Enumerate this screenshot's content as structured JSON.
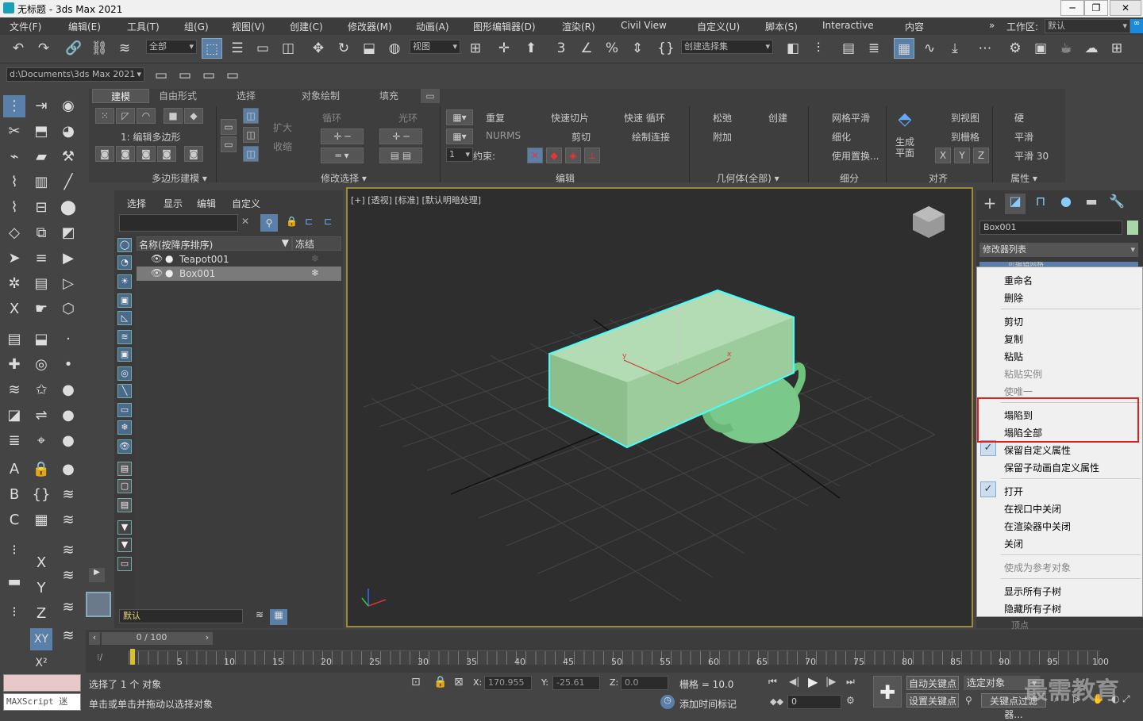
{
  "window": {
    "title": "无标题 - 3ds Max 2021",
    "minimize": "─",
    "maximize": "❐",
    "close": "✕"
  },
  "menu": [
    "文件(F)",
    "编辑(E)",
    "工具(T)",
    "组(G)",
    "视图(V)",
    "创建(C)",
    "修改器(M)",
    "动画(A)",
    "图形编辑器(D)",
    "渲染(R)",
    "Civil View",
    "自定义(U)",
    "脚本(S)",
    "Interactive",
    "内容"
  ],
  "workspace": {
    "label": "工作区:",
    "value": "默认",
    "chevron": "»"
  },
  "toolbar": {
    "selection_filter": "全部",
    "ref_coord": "视图",
    "named_selection": "创建选择集",
    "project_path": "d:\\Documents\\3ds Max 2021"
  },
  "ribbon": {
    "tabs": [
      "建模",
      "自由形式",
      "选择",
      "对象绘制",
      "填充"
    ],
    "poly_level": "1: 编辑多边形",
    "grow": "扩大",
    "shrink": "收缩",
    "loop": "循环",
    "ring": "光环",
    "repeat": "重复",
    "quickslice": "快速切片",
    "quickloop": "快速 循环",
    "nurms": "NURMS",
    "cut": "剪切",
    "paintconnect": "绘制连接",
    "constraint": "约束:",
    "spinner": "1",
    "relax": "松弛",
    "create": "创建",
    "attach": "附加",
    "meshsmooth": "网格平滑",
    "tessellate": "细化",
    "usedisp": "使用置换...",
    "makeplanar": "生成\n平面",
    "toview": "到视图",
    "togrid": "到栅格",
    "xyz": [
      "X",
      "Y",
      "Z"
    ],
    "hard": "硬",
    "smooth": "平滑",
    "smooth30": "平滑 30",
    "sections": [
      "多边形建模 ▾",
      "修改选择 ▾",
      "编辑",
      "几何体(全部) ▾",
      "细分",
      "对齐",
      "属性 ▾"
    ]
  },
  "explorer": {
    "tabs": [
      "选择",
      "显示",
      "编辑",
      "自定义"
    ],
    "col_name": "名称(按降序排序)",
    "col_freeze": "冻结",
    "rows": [
      {
        "name": "Teapot001",
        "selected": false
      },
      {
        "name": "Box001",
        "selected": true
      }
    ],
    "layer": "默认"
  },
  "viewport": {
    "label": "[+] [透视] [标准] [默认明暗处理]",
    "axes": [
      "x",
      "y",
      "z"
    ]
  },
  "cmdpanel": {
    "object_name": "Box001",
    "modlist_label": "修改器列表",
    "obscured": "可编辑网格",
    "bottom": "顶点"
  },
  "context_menu": {
    "items": [
      {
        "label": "重命名",
        "disabled": false,
        "checked": false
      },
      {
        "label": "删除",
        "disabled": false,
        "checked": false
      },
      {
        "label": "剪切",
        "disabled": false,
        "checked": false
      },
      {
        "label": "复制",
        "disabled": false,
        "checked": false
      },
      {
        "label": "粘贴",
        "disabled": false,
        "checked": false
      },
      {
        "label": "粘贴实例",
        "disabled": true,
        "checked": false
      },
      {
        "label": "使唯一",
        "disabled": true,
        "checked": false
      },
      {
        "label": "塌陷到",
        "disabled": false,
        "checked": false
      },
      {
        "label": "塌陷全部",
        "disabled": false,
        "checked": false
      },
      {
        "label": "保留自定义属性",
        "disabled": false,
        "checked": true
      },
      {
        "label": "保留子动画自定义属性",
        "disabled": false,
        "checked": false
      },
      {
        "label": "打开",
        "disabled": false,
        "checked": true
      },
      {
        "label": "在视口中关闭",
        "disabled": false,
        "checked": false
      },
      {
        "label": "在渲染器中关闭",
        "disabled": false,
        "checked": false
      },
      {
        "label": "关闭",
        "disabled": false,
        "checked": false
      },
      {
        "label": "使成为参考对象",
        "disabled": true,
        "checked": false
      },
      {
        "label": "显示所有子树",
        "disabled": false,
        "checked": false
      },
      {
        "label": "隐藏所有子树",
        "disabled": false,
        "checked": false
      }
    ]
  },
  "timeline": {
    "frame": "0 / 100",
    "ticks": [
      "5",
      "10",
      "15",
      "20",
      "25",
      "30",
      "35",
      "40",
      "45",
      "50",
      "55",
      "60",
      "65",
      "70",
      "75",
      "80",
      "85",
      "90",
      "95",
      "100"
    ]
  },
  "status": {
    "selected": "选择了 1 个 对象",
    "hint": "单击或单击并拖动以选择对象",
    "x_label": "X:",
    "x": "170.955",
    "y_label": "Y:",
    "y": "-25.61",
    "z_label": "Z:",
    "z": "0.0",
    "grid": "栅格 = 10.0",
    "add_time_tag": "添加时间标记",
    "autokey": "自动关键点",
    "setkey": "设置关键点",
    "selected_obj": "选定对象",
    "keyfilters": "关键点过滤器...",
    "frame_field": "0",
    "maxscript": "MAXScript 迷",
    "watermark": "最需教育"
  }
}
